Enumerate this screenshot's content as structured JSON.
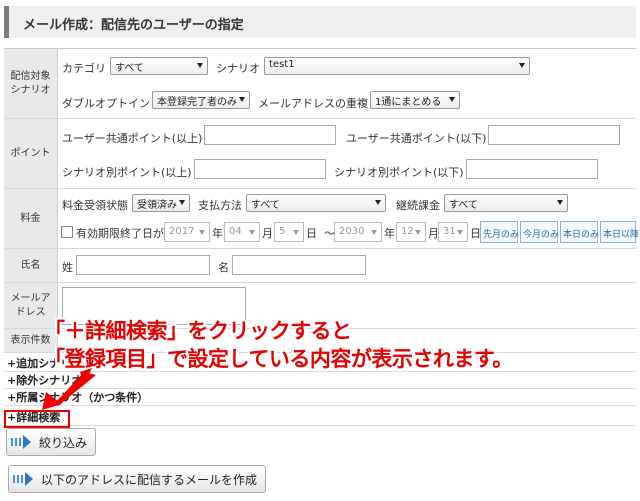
{
  "page": {
    "title": "メール作成：配信先のユーザーの指定"
  },
  "rows": {
    "scenario": {
      "label": "配信対象\nシナリオ",
      "category_label": "カテゴリ",
      "category_value": "すべて",
      "scenario_label": "シナリオ",
      "scenario_value": "test1",
      "double_optin_label": "ダブルオプトイン",
      "double_optin_value": "本登録完了者のみ",
      "duplicate_label": "メールアドレスの重複",
      "duplicate_value": "1通にまとめる"
    },
    "points": {
      "label": "ポイント",
      "common_min_label": "ユーザー共通ポイント(以上)",
      "common_max_label": "ユーザー共通ポイント(以下)",
      "scenario_min_label": "シナリオ別ポイント(以上)",
      "scenario_max_label": "シナリオ別ポイント(以下)"
    },
    "fee": {
      "label": "料金",
      "payment_status_label": "料金受領状態",
      "payment_status_value": "受領済み",
      "payment_method_label": "支払方法",
      "payment_method_value": "すべて",
      "recurring_label": "継続課金",
      "recurring_value": "すべて",
      "expiry_label": "有効期限終了日が",
      "from_year": "2017",
      "year_unit": "年",
      "from_month": "04",
      "month_unit": "月",
      "from_day": "5",
      "day_unit": "日",
      "tilde": "～",
      "to_year": "2030",
      "to_month": "12",
      "to_day": "31",
      "preset_buttons": [
        "先月のみ",
        "今月のみ",
        "本日のみ",
        "本日以降"
      ]
    },
    "name": {
      "label": "氏名",
      "last_label": "姓",
      "first_label": "名"
    },
    "email": {
      "label": "メールア\nドレス"
    },
    "display_count": {
      "label": "表示件数"
    }
  },
  "sections": [
    "+追加シナリオ",
    "+除外シナリオ",
    "+所属シナリオ（かつ条件）",
    "+詳細検索"
  ],
  "buttons": {
    "filter": "絞り込み",
    "create_mail": "以下のアドレスに配信するメールを作成"
  },
  "callout": {
    "line1": "「＋詳細検索」をクリックすると",
    "line2": "「登録項目」で設定している内容が表示されます。"
  },
  "colors": {
    "callout": "#e60000",
    "preset_button_text": "#2b6aa6"
  }
}
